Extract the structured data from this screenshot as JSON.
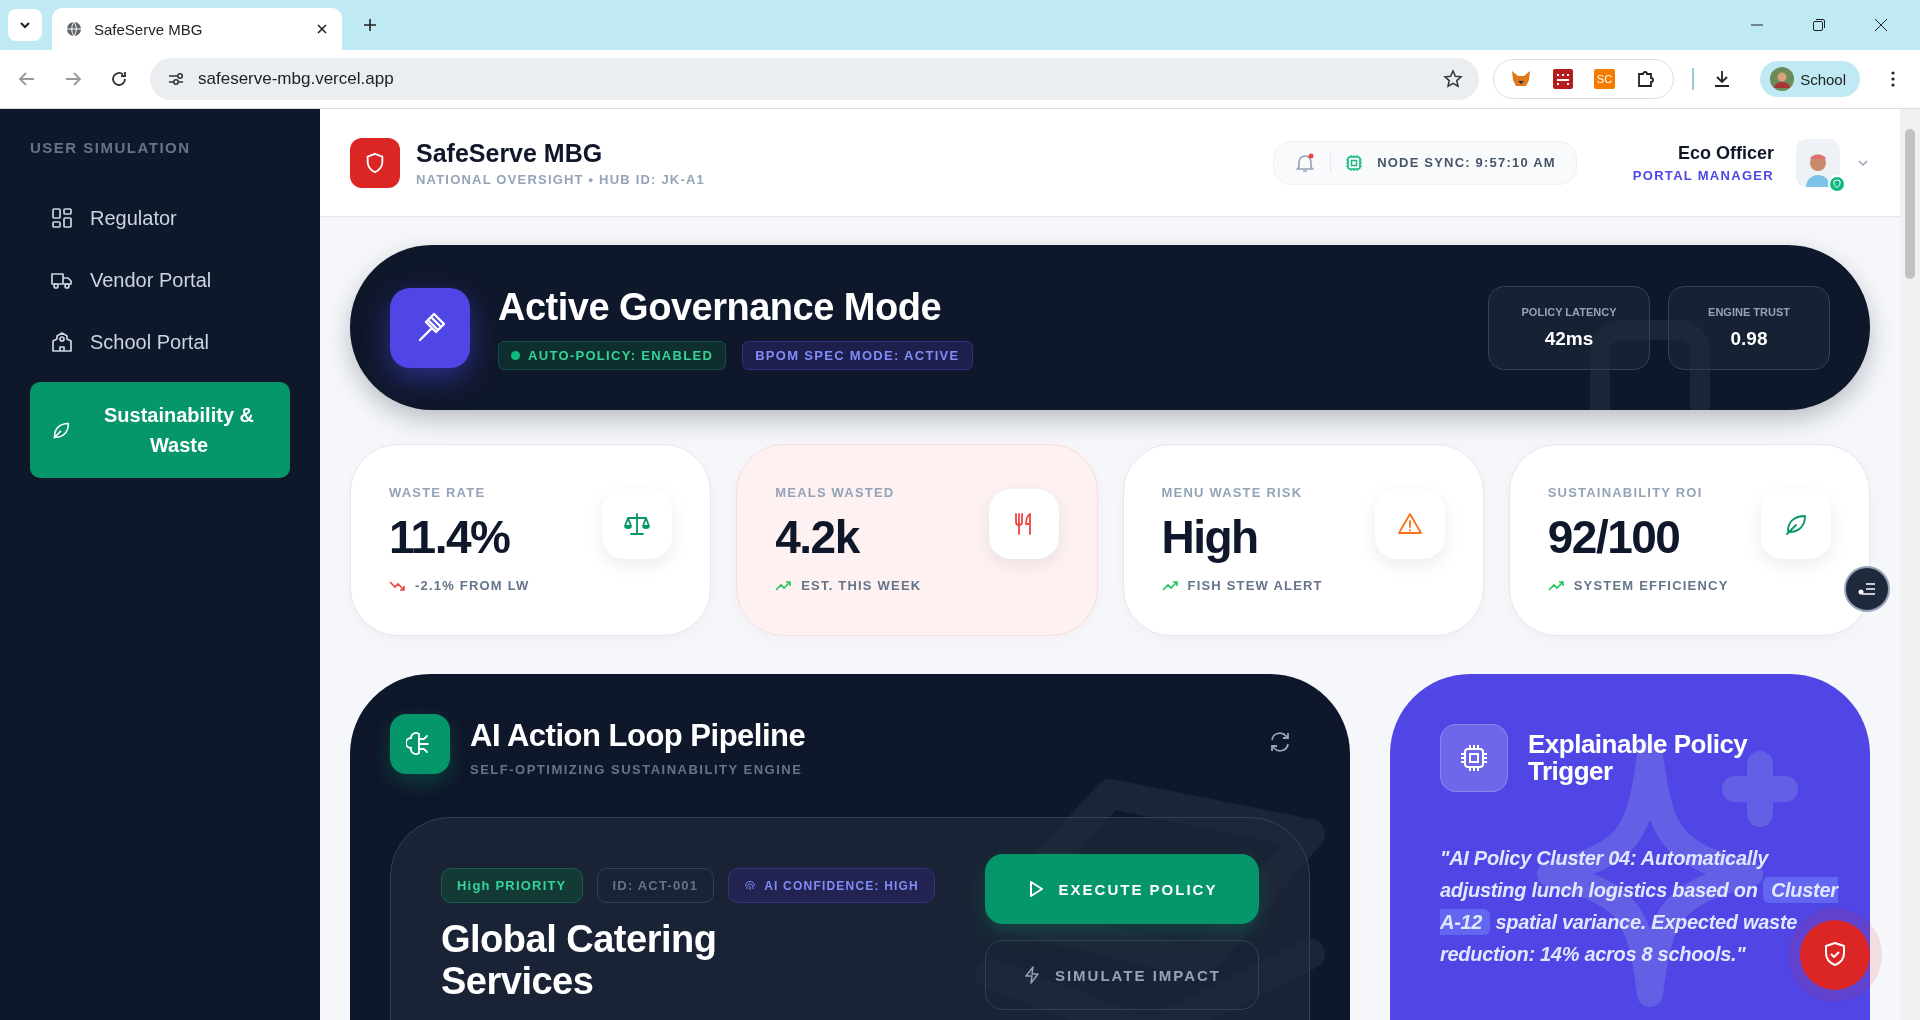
{
  "browser": {
    "tab_title": "SafeServe MBG",
    "url": "safeserve-mbg.vercel.app",
    "profile": "School",
    "extensions": [
      {
        "kind": "fox"
      },
      {
        "kind": "grid"
      },
      {
        "kind": "badge",
        "label": "SC"
      },
      {
        "kind": "puzzle"
      }
    ]
  },
  "sidebar": {
    "heading": "USER SIMULATION",
    "items": [
      {
        "label": "Regulator",
        "selected": false
      },
      {
        "label": "Vendor Portal",
        "selected": false
      },
      {
        "label": "School Portal",
        "selected": false
      },
      {
        "label": "Sustainability & Waste",
        "selected": true
      }
    ]
  },
  "header": {
    "title": "SafeServe MBG",
    "subtitle": "NATIONAL OVERSIGHT • HUB ID: JK-A1",
    "notification_unread": true,
    "sync": "NODE SYNC: 9:57:10 AM",
    "user_name": "Eco Officer",
    "user_role": "PORTAL MANAGER",
    "online": true
  },
  "banner": {
    "title": "Active Governance Mode",
    "badges": [
      {
        "kind": "status",
        "label": "AUTO-POLICY: ENABLED"
      },
      {
        "kind": "mode",
        "label": "BPOM SPEC MODE: ACTIVE"
      }
    ],
    "stats": [
      {
        "label": "POLICY LATENCY",
        "value": "42ms"
      },
      {
        "label": "ENGINE TRUST",
        "value": "0.98"
      }
    ]
  },
  "metrics": [
    {
      "label": "WASTE RATE",
      "value": "11.4%",
      "declining": true,
      "note": "-2.1% FROM LW",
      "highlighted": false
    },
    {
      "label": "MEALS WASTED",
      "value": "4.2k",
      "declining": false,
      "note": "EST. THIS WEEK",
      "highlighted": true
    },
    {
      "label": "MENU WASTE RISK",
      "value": "High",
      "declining": false,
      "note": "FISH STEW ALERT",
      "highlighted": false
    },
    {
      "label": "SUSTAINABILITY ROI",
      "value": "92/100",
      "declining": false,
      "note": "SYSTEM EFFICIENCY",
      "highlighted": false
    }
  ],
  "pipeline": {
    "title": "AI Action Loop Pipeline",
    "subtitle": "SELF-OPTIMIZING SUSTAINABILITY ENGINE",
    "action": {
      "tags": [
        {
          "kind": "priority",
          "label": "High PRIORITY"
        },
        {
          "kind": "id",
          "label": "ID: ACT-001"
        },
        {
          "kind": "confidence",
          "label": "AI CONFIDENCE: HIGH"
        }
      ],
      "vendor": "Global Catering Services",
      "buttons": [
        {
          "kind": "primary",
          "label": "EXECUTE POLICY"
        },
        {
          "kind": "secondary",
          "label": "SIMULATE IMPACT"
        }
      ]
    }
  },
  "policy_trigger": {
    "title": "Explainable Policy Trigger",
    "quote_before": "\"AI Policy Cluster 04: Automatically adjusting lunch logistics based on",
    "quote_highlight": "Cluster A-12",
    "quote_after": "spatial variance. Expected waste reduction: 14% acros 8 schools.\""
  }
}
